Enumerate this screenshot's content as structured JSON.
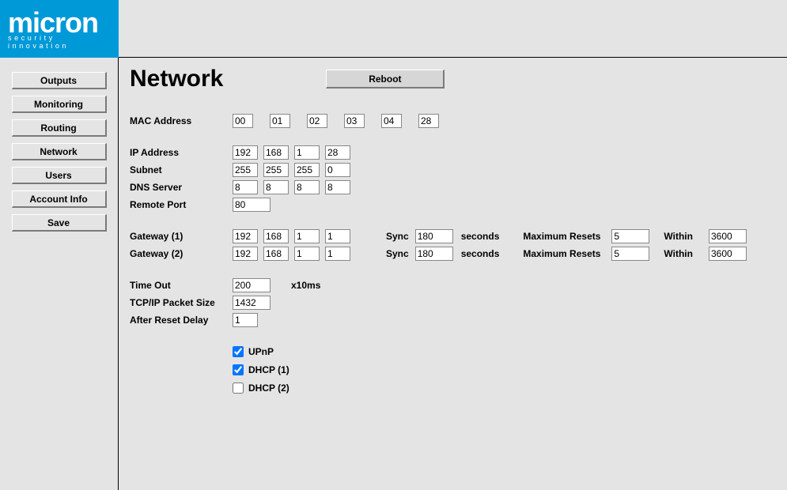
{
  "logo": {
    "title": "micron",
    "subtitle": "security innovation"
  },
  "nav": {
    "outputs": "Outputs",
    "monitoring": "Monitoring",
    "routing": "Routing",
    "network": "Network",
    "users": "Users",
    "account": "Account Info",
    "save": "Save"
  },
  "page": {
    "title": "Network",
    "reboot": "Reboot"
  },
  "labels": {
    "mac": "MAC Address",
    "ip": "IP Address",
    "subnet": "Subnet",
    "dns": "DNS Server",
    "rport": "Remote Port",
    "gw1": "Gateway (1)",
    "gw2": "Gateway (2)",
    "sync": "Sync",
    "seconds": "seconds",
    "maxresets": "Maximum Resets",
    "within": "Within",
    "timeout": "Time Out",
    "timeout_unit": "x10ms",
    "pktsize": "TCP/IP Packet Size",
    "resetdelay": "After Reset Delay",
    "upnp": "UPnP",
    "dhcp1": "DHCP  (1)",
    "dhcp2": "DHCP  (2)"
  },
  "values": {
    "mac": [
      "00",
      "01",
      "02",
      "03",
      "04",
      "28"
    ],
    "ip": [
      "192",
      "168",
      "1",
      "28"
    ],
    "subnet": [
      "255",
      "255",
      "255",
      "0"
    ],
    "dns": [
      "8",
      "8",
      "8",
      "8"
    ],
    "rport": "80",
    "gw1": {
      "ip": [
        "192",
        "168",
        "1",
        "1"
      ],
      "sync": "180",
      "maxresets": "5",
      "within": "3600"
    },
    "gw2": {
      "ip": [
        "192",
        "168",
        "1",
        "1"
      ],
      "sync": "180",
      "maxresets": "5",
      "within": "3600"
    },
    "timeout": "200",
    "pktsize": "1432",
    "resetdelay": "1",
    "upnp": true,
    "dhcp1": true,
    "dhcp2": false
  }
}
